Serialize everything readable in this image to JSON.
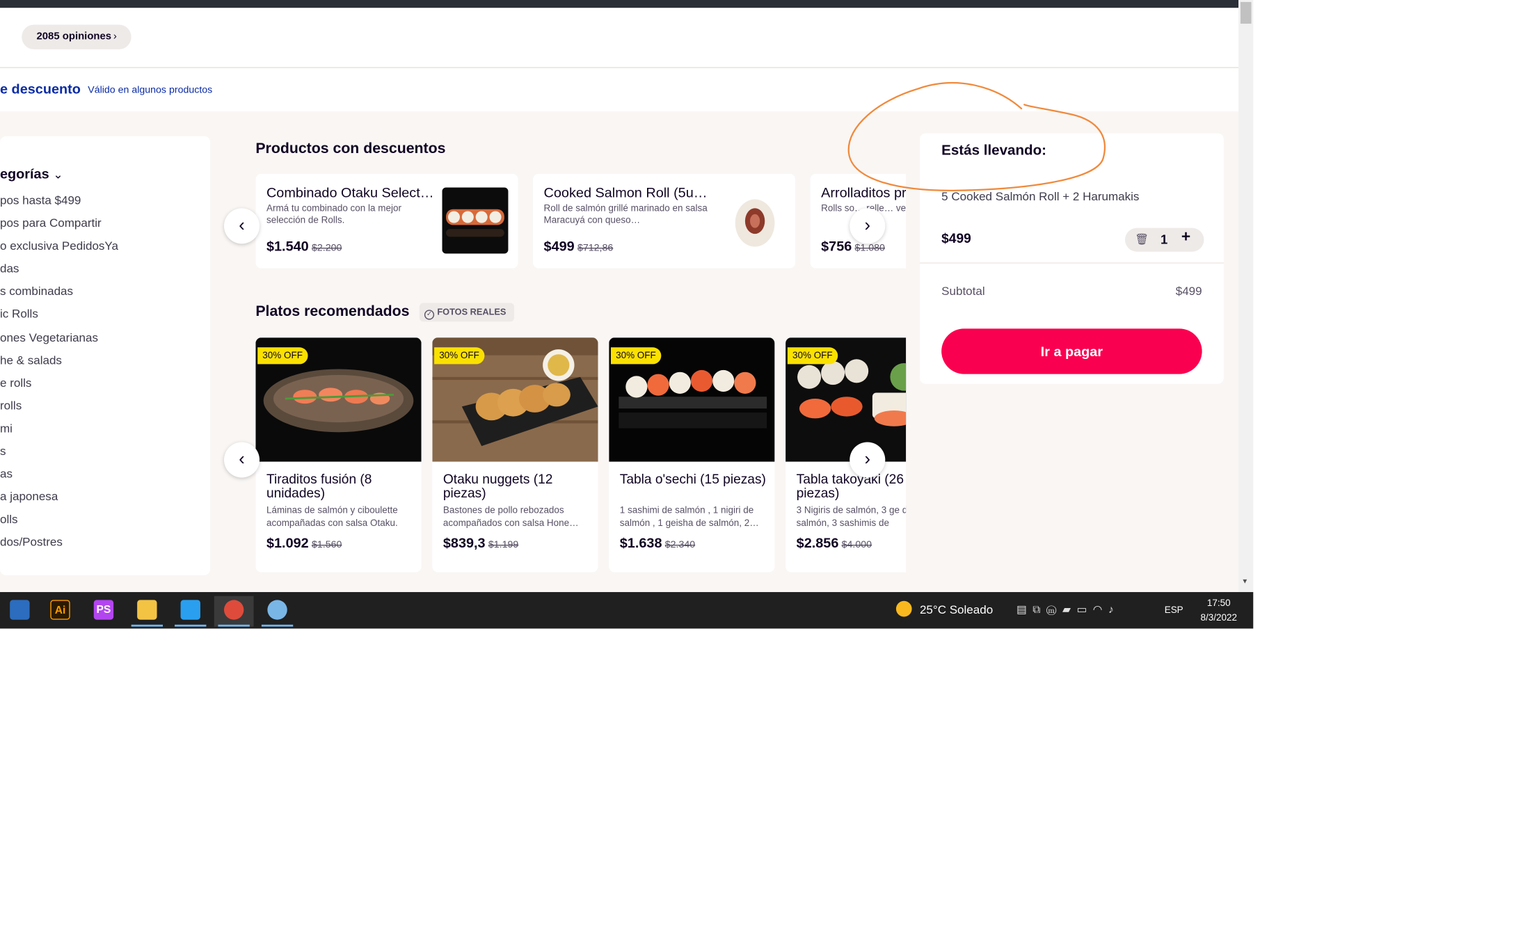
{
  "header": {
    "reviews_label": "2085 opiniones",
    "discount_title": "e descuento",
    "discount_sub": "Válido en algunos productos"
  },
  "categories": {
    "title": "egorías",
    "items": [
      "pos hasta $499",
      "pos para Compartir",
      "o exclusiva PedidosYa",
      "das",
      "s combinadas",
      "ic Rolls",
      "ones Vegetarianas",
      "he & salads",
      "e rolls",
      "rolls",
      "mi",
      "s",
      "as",
      "a japonesa",
      "olls",
      "dos/Postres"
    ]
  },
  "discount_section": {
    "title": "Productos con descuentos",
    "cards": [
      {
        "name": "Combinado Otaku Select…",
        "desc": "Armá tu combinado con la mejor selección de Rolls.",
        "price": "$1.540",
        "old_price": "$2.200"
      },
      {
        "name": "Cooked Salmon Roll (5u) …",
        "desc": "Roll de salmón grillé marinado en salsa Maracuyá con queso…",
        "price": "$499",
        "old_price": "$712,86"
      },
      {
        "name": "Arrolladitos pri",
        "desc": "Rolls so… relle… verdu… npañ",
        "price": "$756",
        "old_price": "$1.080"
      }
    ]
  },
  "recommended_section": {
    "title": "Platos recomendados",
    "tag": "FOTOS REALES",
    "cards": [
      {
        "badge": "30% OFF",
        "name": "Tiraditos fusión (8 unidades)",
        "desc": "Láminas de salmón y ciboulette acompañadas con salsa Otaku.",
        "price": "$1.092",
        "old_price": "$1.560"
      },
      {
        "badge": "30% OFF",
        "name": "Otaku nuggets (12 piezas)",
        "desc": "Bastones de pollo rebozados acompañados con salsa Hone…",
        "price": "$839,3",
        "old_price": "$1.199"
      },
      {
        "badge": "30% OFF",
        "name": "Tabla o'sechi (15 piezas)",
        "desc": "1 sashimi de salmón , 1 nigiri de salmón , 1 geisha de salmón, 2…",
        "price": "$1.638",
        "old_price": "$2.340"
      },
      {
        "badge": "30% OFF",
        "name": "Tabla takoyaki (26 piezas)",
        "desc": "3 Nigiris de salmón, 3 ge de salmón, 3 sashimis de",
        "price": "$2.856",
        "old_price": "$4.000"
      }
    ]
  },
  "cart": {
    "title": "Estás llevando:",
    "item": "5 Cooked Salmón Roll + 2 Harumakis",
    "price": "$499",
    "qty": "1",
    "subtotal_label": "Subtotal",
    "subtotal_value": "$499",
    "pay_label": "Ir a pagar"
  },
  "taskbar": {
    "weather": "25°C  Soleado",
    "lang": "ESP",
    "time": "17:50",
    "date": "8/3/2022",
    "apps": [
      {
        "name": "explorer-tool-icon",
        "glyph": "",
        "color": "#2c6dbf"
      },
      {
        "name": "illustrator-icon",
        "glyph": "Ai",
        "color": "#ff9a00"
      },
      {
        "name": "phpstorm-icon",
        "glyph": "PS",
        "color": "#b345f1"
      },
      {
        "name": "file-explorer-icon",
        "glyph": "",
        "color": "#f3c344"
      },
      {
        "name": "vscode-icon",
        "glyph": "",
        "color": "#2a9ff0"
      },
      {
        "name": "chrome-icon",
        "glyph": "",
        "color": "#de4b3b"
      },
      {
        "name": "paint-icon",
        "glyph": "",
        "color": "#79b6e6"
      }
    ]
  },
  "colors": {
    "brand": "#fa0050",
    "discount_blue": "#0a2ba6",
    "badge_yellow": "#fae100",
    "annotation": "#f08a3c"
  }
}
